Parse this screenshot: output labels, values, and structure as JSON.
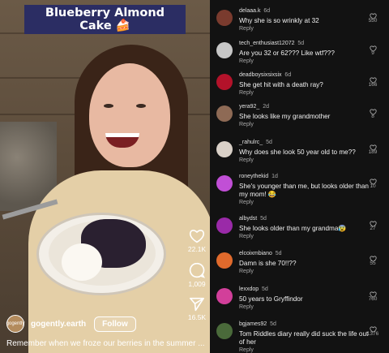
{
  "video": {
    "title_line1": "Blueberry Almond",
    "title_line2": "Cake 🍰",
    "author": "gogently.earth",
    "author_avatar_text": "gogently",
    "follow_label": "Follow",
    "caption": "Remember when we froze our berries in the summer ...",
    "likes": "22.1K",
    "comments_count": "1,009",
    "shares": "16.5K"
  },
  "comments": [
    {
      "user": "delaaa.k",
      "age": "6d",
      "text": "Why she is so wrinkly at 32",
      "reply": "Reply",
      "likes": "550",
      "avatar_color": "#7a3b2e"
    },
    {
      "user": "tech_enthusiast12072",
      "age": "5d",
      "text": "Are you 32 or 62??? Like wtf???",
      "reply": "Reply",
      "likes": "9",
      "avatar_color": "#c7c7c7"
    },
    {
      "user": "deadboysixsixsix",
      "age": "6d",
      "text": "She get hit with a death ray?",
      "reply": "Reply",
      "likes": "166",
      "avatar_color": "#b3122a"
    },
    {
      "user": "yera92_",
      "age": "2d",
      "text": "She looks like my grandmother",
      "reply": "Reply",
      "likes": "8",
      "avatar_color": "#8e6a55"
    },
    {
      "user": "_rahulrc_",
      "age": "5d",
      "text": "Why does she look 50 year old to me??",
      "reply": "Reply",
      "likes": "189",
      "avatar_color": "#d9d0c7"
    },
    {
      "user": "roneythekid",
      "age": "1d",
      "text": "She's younger than me, but looks older than my mom! 😂",
      "reply": "Reply",
      "likes": "10",
      "avatar_color": "#c14fd6"
    },
    {
      "user": "albydst",
      "age": "5d",
      "text": "She looks older than my grandma😰",
      "reply": "Reply",
      "likes": "27",
      "avatar_color": "#9a2aa8"
    },
    {
      "user": "elcoixmbiano",
      "age": "5d",
      "text": "Damn is she 70!!??",
      "reply": "Reply",
      "likes": "55",
      "avatar_color": "#e06a2c"
    },
    {
      "user": "lexxdop",
      "age": "5d",
      "text": "50 years to Gryffindor",
      "reply": "Reply",
      "likes": "760",
      "avatar_color": "#d23f9a"
    },
    {
      "user": "bgjames92",
      "age": "5d",
      "text": "Tom Riddles diary really did suck the life out of her",
      "reply": "Reply",
      "likes": "1376",
      "avatar_color": "#4a6a3a"
    }
  ]
}
